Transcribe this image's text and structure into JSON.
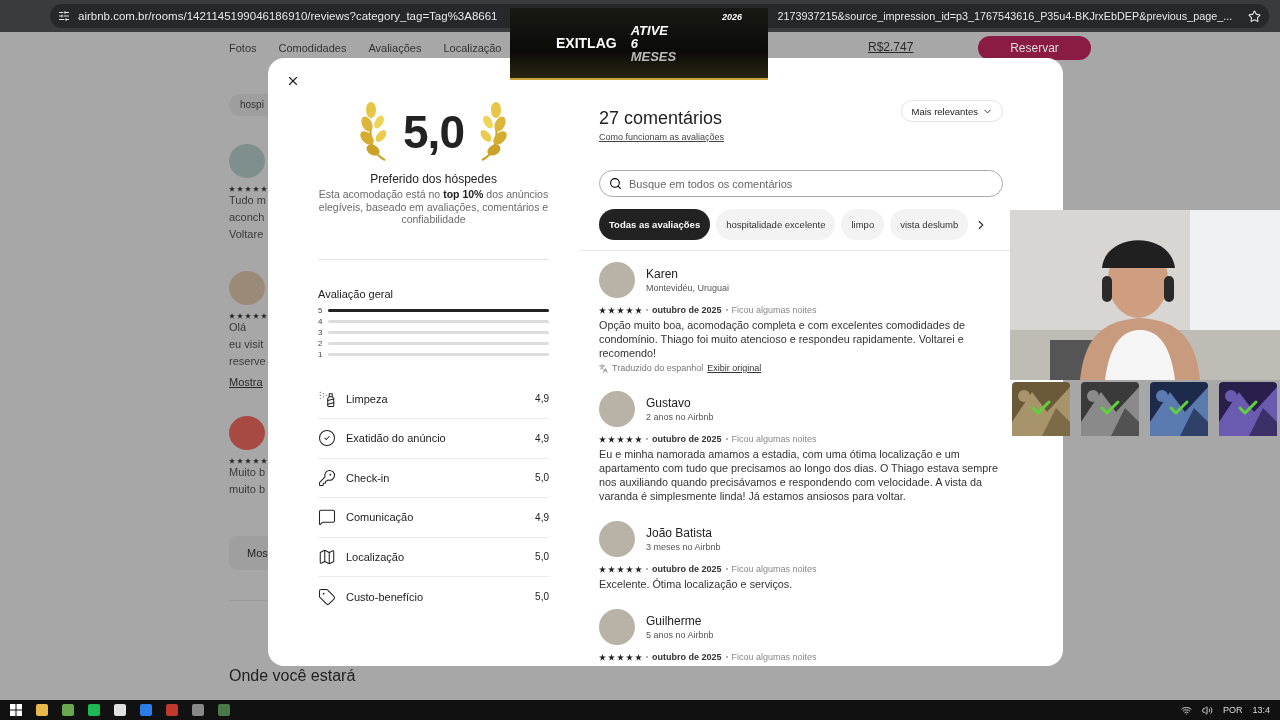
{
  "browser": {
    "url_start": "airbnb.com.br/rooms/1421145199046186910/reviews?category_tag=Tag%3A8661",
    "url_end": "2173937215&source_impression_id=p3_1767543616_P35u4-BKJrxEbDEP&previous_page_..."
  },
  "ad_banner": {
    "brand": "EXITLAG",
    "line_1": "ATIVE",
    "line_2": "6",
    "line_3": "MESES",
    "year": "2026"
  },
  "page": {
    "nav": [
      "Fotos",
      "Comodidades",
      "Avaliações",
      "Localização"
    ],
    "price": "R$2.747",
    "reserve_button": "Reservar",
    "tag_chip": "hospi",
    "reviews": [
      {
        "stars": 5,
        "lines": [
          "Tudo m",
          "aconch",
          "Voltare"
        ]
      },
      {
        "stars": 5,
        "lines": [
          "Olá",
          "eu visit",
          "reserve"
        ],
        "link": "Mostra"
      },
      {
        "stars": 5,
        "lines": [
          "Muito b",
          "muito b"
        ]
      }
    ],
    "show_more_button": "Mos",
    "section_title": "Onde você estará"
  },
  "modal": {
    "rating": "5,0",
    "badge_title": "Preferido dos hóspedes",
    "badge_text": "Esta acomodação está no **top 10%** dos anúncios elegíveis, baseado em avaliações, comentários e confiabilidade",
    "overall_title": "Avaliação geral",
    "overall_bars": [
      {
        "label": "5",
        "level": 1
      },
      {
        "label": "4",
        "level": 0
      },
      {
        "label": "3",
        "level": 0
      },
      {
        "label": "2",
        "level": 0
      },
      {
        "label": "1",
        "level": 0
      }
    ],
    "categories": [
      {
        "kind": "cleaning",
        "label": "Limpeza",
        "value": "4,9"
      },
      {
        "kind": "accuracy",
        "label": "Exatidão do anúncio",
        "value": "4,9"
      },
      {
        "kind": "checkin",
        "label": "Check-in",
        "value": "5,0"
      },
      {
        "kind": "communication",
        "label": "Comunicação",
        "value": "4,9"
      },
      {
        "kind": "location",
        "label": "Localização",
        "value": "5,0"
      },
      {
        "kind": "value",
        "label": "Custo-benefício",
        "value": "5,0"
      }
    ],
    "reviews_title": "27 comentários",
    "how_link": "Como funcionam as avaliações",
    "sort": "Mais relevantes",
    "search": {
      "placeholder": "Busque em todos os comentários"
    },
    "chips": [
      {
        "label": "Todas as avaliações",
        "selected": true
      },
      {
        "label": "hospitalidade excelente",
        "selected": false
      },
      {
        "label": "limpo",
        "selected": false
      },
      {
        "label": "vista deslumb",
        "selected": false
      }
    ],
    "reviews": [
      {
        "name": "Karen",
        "subtitle": "Montevidéu, Uruguai",
        "stars": 5,
        "date": "outubro de 2025",
        "stay": "Ficou algumas noites",
        "text": "Opção muito boa, acomodação completa e com excelentes comodidades de condomínio. Thiago foi muito atencioso e respondeu rapidamente. Voltarei e recomendo!",
        "note": "Traduzido do espanhol",
        "note_link": "Exibir original"
      },
      {
        "name": "Gustavo",
        "subtitle": "2 anos no Airbnb",
        "stars": 5,
        "date": "outubro de 2025",
        "stay": "Ficou algumas noites",
        "text": "Eu e minha namorada amamos a estadia, com uma ótima localização e um apartamento com tudo que precisamos ao longo dos dias. O Thiago estava sempre nos auxiliando quando precisávamos e respondendo com velocidade. A vista da varanda é simplesmente linda! Já estamos ansiosos para voltar."
      },
      {
        "name": "João Batista",
        "subtitle": "3 meses no Airbnb",
        "stars": 5,
        "date": "outubro de 2025",
        "stay": "Ficou algumas noites",
        "text": "Excelente. Ótima localização e serviços."
      },
      {
        "name": "Guilherme",
        "subtitle": "5 anos no Airbnb",
        "stars": 5,
        "date": "outubro de 2025",
        "stay": "Ficou algumas noites"
      }
    ]
  },
  "taskbar": {
    "language": "POR",
    "time": "13:4"
  }
}
